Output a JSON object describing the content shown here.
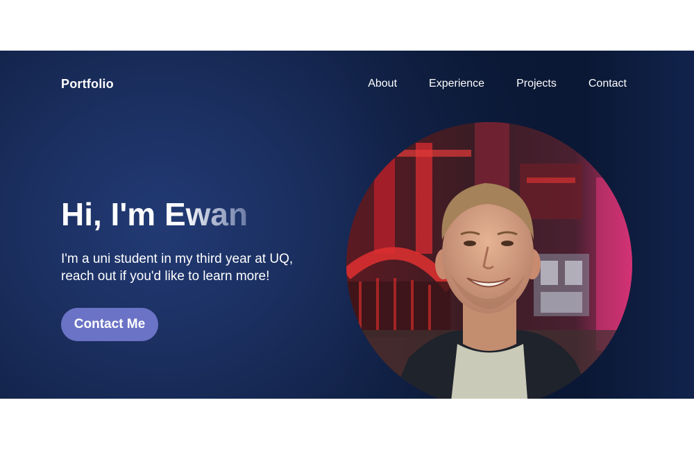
{
  "header": {
    "logo": "Portfolio",
    "nav": [
      {
        "label": "About"
      },
      {
        "label": "Experience"
      },
      {
        "label": "Projects"
      },
      {
        "label": "Contact"
      }
    ]
  },
  "hero": {
    "headline": "Hi, I'm Ewan",
    "intro_line1": "I'm a uni student in my third year at UQ,",
    "intro_line2": "reach out if you'd like to learn more!",
    "cta_label": "Contact Me"
  },
  "colors": {
    "hero_background": "#13244b",
    "cta_background": "#6b73c6",
    "text": "#ffffff"
  }
}
